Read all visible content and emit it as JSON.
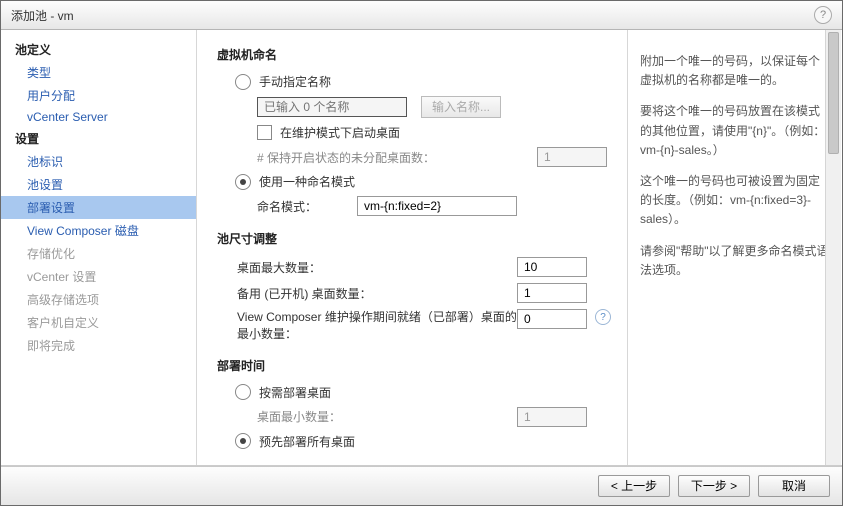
{
  "title": "添加池 - vm",
  "sidebar": {
    "g1": {
      "title": "池定义",
      "items": [
        "类型",
        "用户分配",
        "vCenter Server"
      ]
    },
    "g2": {
      "title": "设置",
      "items": [
        "池标识",
        "池设置",
        "部署设置",
        "View Composer 磁盘",
        "存储优化",
        "vCenter 设置",
        "高级存储选项",
        "客户机自定义",
        "即将完成"
      ]
    }
  },
  "form": {
    "s1": {
      "title": "虚拟机命名",
      "manual": "手动指定名称",
      "placeholder": "已输入 0 个名称",
      "enterBtn": "输入名称...",
      "maint": "在维护模式下启动桌面",
      "unassigned": "# 保持开启状态的未分配桌面数：",
      "unassignedVal": "1",
      "usePattern": "使用一种命名模式",
      "patternLabel": "命名模式：",
      "patternVal": "vm-{n:fixed=2}"
    },
    "s2": {
      "title": "池尺寸调整",
      "max": "桌面最大数量：",
      "maxVal": "10",
      "spare": "备用 (已开机) 桌面数量：",
      "spareVal": "1",
      "minReady": "View Composer 维护操作期间就绪（已部署）桌面的最小数量：",
      "minReadyVal": "0"
    },
    "s3": {
      "title": "部署时间",
      "onDemand": "按需部署桌面",
      "minDesk": "桌面最小数量：",
      "minDeskVal": "1",
      "upfront": "预先部署所有桌面"
    }
  },
  "help": {
    "p1": "附加一个唯一的号码，以保证每个虚拟机的名称都是唯一的。",
    "p2": "要将这个唯一的号码放置在该模式的其他位置，请使用\"{n}\"。（例如：vm-{n}-sales。）",
    "p3": "这个唯一的号码也可被设置为固定的长度。（例如：vm-{n:fixed=3}-sales）。",
    "p4": "请参阅\"帮助\"以了解更多命名模式语法选项。"
  },
  "footer": {
    "back": "< 上一步",
    "next": "下一步 >",
    "cancel": "取消"
  }
}
